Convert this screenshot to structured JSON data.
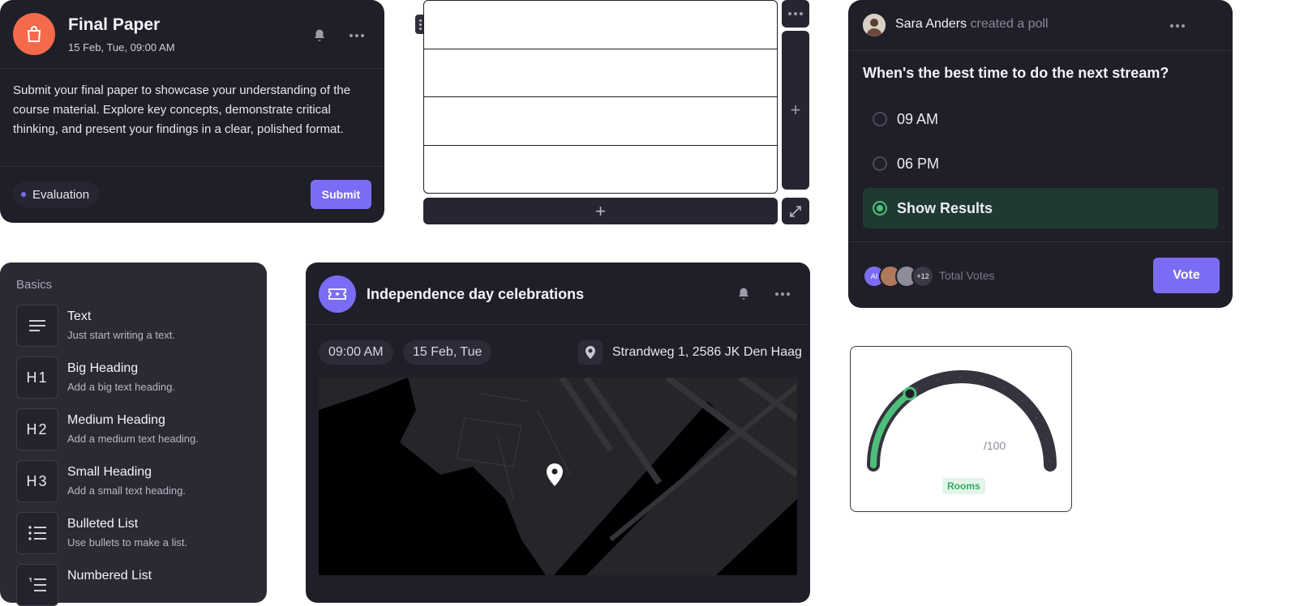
{
  "final_paper": {
    "title": "Final Paper",
    "date": "15 Feb, Tue, 09:00 AM",
    "body": "Submit your final paper to showcase your understanding of the course material. Explore key concepts, demonstrate critical thinking, and present your findings in a clear, polished format.",
    "tag": "Evaluation",
    "submit_label": "Submit",
    "accent": "#f46a4b"
  },
  "table_widget": {
    "rows": 4,
    "add_symbol": "+"
  },
  "poll": {
    "author": "Sara Anders",
    "action": "created a poll",
    "question": "When's the best time to do the next stream?",
    "options": [
      {
        "label": "09 AM",
        "selected": false
      },
      {
        "label": "06 PM",
        "selected": false
      },
      {
        "label": "Show Results",
        "selected": true
      }
    ],
    "voters": [
      {
        "initials": "AI",
        "color": "#7b6cf6"
      },
      {
        "initials": "",
        "color": "#b07a5a"
      },
      {
        "initials": "",
        "color": "#8d8d9a"
      }
    ],
    "voters_more": "+12",
    "total_label": "Total Votes",
    "vote_label": "Vote",
    "accent": "#7b6cf6",
    "selected_color": "#4cc07a"
  },
  "basics": {
    "title": "Basics",
    "items": [
      {
        "icon": "text-lines-icon",
        "glyph": "",
        "name": "Text",
        "desc": "Just start writing a text."
      },
      {
        "icon": "h1-icon",
        "glyph": "H1",
        "name": "Big Heading",
        "desc": "Add a big text heading."
      },
      {
        "icon": "h2-icon",
        "glyph": "H2",
        "name": "Medium Heading",
        "desc": "Add a medium text heading."
      },
      {
        "icon": "h3-icon",
        "glyph": "H3",
        "name": "Small Heading",
        "desc": "Add a small text heading."
      },
      {
        "icon": "bulleted-list-icon",
        "glyph": "",
        "name": "Bulleted List",
        "desc": "Use bullets to make a list."
      },
      {
        "icon": "numbered-list-icon",
        "glyph": "",
        "name": "Numbered List",
        "desc": ""
      }
    ]
  },
  "event": {
    "title": "Independence day celebrations",
    "time": "09:00 AM",
    "date": "15 Feb, Tue",
    "location": "Strandweg 1, 2586 JK Den Haag",
    "accent": "#7b6cf6"
  },
  "gauge": {
    "max_label": "/100",
    "badge": "Rooms",
    "fraction": 0.3,
    "fill_color": "#4cc07a"
  }
}
